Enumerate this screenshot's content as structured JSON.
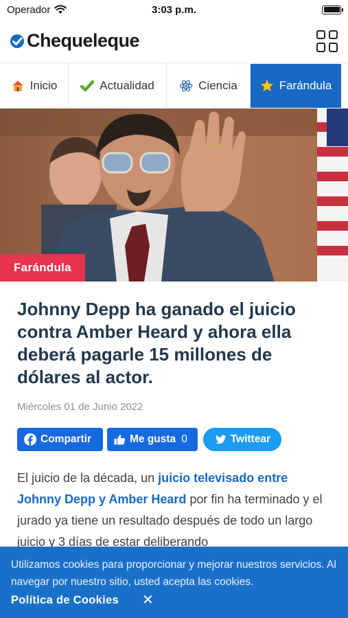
{
  "status_bar": {
    "carrier": "Operador",
    "time": "3:03 p.m.",
    "battery_level": 1.0
  },
  "header": {
    "logo_text": "Chequeleque",
    "menu_icon": "grid-icon"
  },
  "nav": {
    "tabs": [
      {
        "label": "Inicio",
        "icon": "house-icon",
        "active": false
      },
      {
        "label": "Actualidad",
        "icon": "checkmark-icon",
        "active": false
      },
      {
        "label": "Ciencia",
        "icon": "atom-icon",
        "active": false
      },
      {
        "label": "Farándula",
        "icon": "star-icon",
        "active": true
      }
    ]
  },
  "hero": {
    "category": "Farándula"
  },
  "article": {
    "headline": "Johnny Depp ha ganado el juicio contra Amber Heard y ahora ella deberá pagarle 15 millones de dólares al actor.",
    "date": "Miércoles 01 de Junio 2022",
    "share": {
      "facebook": "Compartir",
      "like": "Me gusta",
      "like_count": "0",
      "twitter": "Twittear"
    },
    "body": {
      "intro": "El juicio de la década, un ",
      "link": "juicio televisado entre Johnny Depp y Amber Heard",
      "rest": " por fin ha terminado y el jurado ya tiene un resultado después de todo un largo juicio y 3 días de estar deliberando"
    }
  },
  "cookie": {
    "text": "Utilizamos cookies para proporcionar y mejorar nuestros servicios. Al navegar por nuestro sitio, usted acepta las cookies.",
    "policy_link": "Política de Cookies",
    "close": "✕"
  },
  "colors": {
    "brand_blue": "#1769c3",
    "badge_red": "#e8354f",
    "facebook": "#1769e0",
    "twitter": "#1d9bf0"
  }
}
